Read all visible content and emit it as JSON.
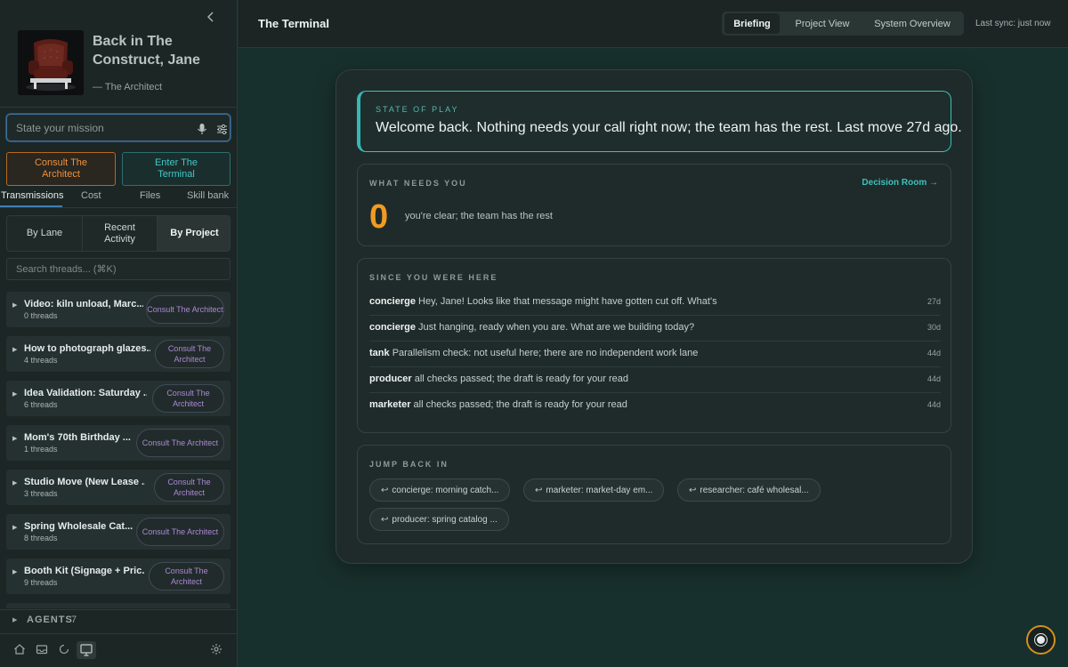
{
  "sidebar": {
    "hero": {
      "title": "Back in The Construct, Jane",
      "attribution": "— The Architect"
    },
    "mission_input": {
      "placeholder": "State your mission",
      "value": ""
    },
    "primary_buttons": {
      "consult": "Consult The Architect",
      "enter": "Enter The Terminal"
    },
    "tabs": [
      "Transmissions",
      "Cost",
      "Files",
      "Skill bank"
    ],
    "active_tab": "Transmissions",
    "grouping": [
      "By Lane",
      "Recent Activity",
      "By Project"
    ],
    "active_grouping": "By Project",
    "thread_search": {
      "placeholder": "Search threads... (⌘K)",
      "value": ""
    },
    "projects": [
      {
        "title": "Video: kiln unload, Marc...",
        "count": "0 threads",
        "action": "Consult The Architect"
      },
      {
        "title": "How to photograph glazes...",
        "count": "4 threads",
        "action": "Consult The Architect"
      },
      {
        "title": "Idea Validation: Saturday ...",
        "count": "6 threads",
        "action": "Consult The Architect"
      },
      {
        "title": "Mom's 70th Birthday ...",
        "count": "1 threads",
        "action": "Consult The Architect"
      },
      {
        "title": "Studio Move (New Lease ...",
        "count": "3 threads",
        "action": "Consult The Architect"
      },
      {
        "title": "Spring Wholesale Cat...",
        "count": "8 threads",
        "action": "Consult The Architect"
      },
      {
        "title": "Booth Kit (Signage + Pric...",
        "count": "9 threads",
        "action": "Consult The Architect"
      }
    ],
    "agents": {
      "label": "AGENTS",
      "count": "7"
    },
    "bottom_icons": [
      "home-icon",
      "inbox-icon",
      "refresh-icon",
      "monitor-icon",
      "gear-icon"
    ]
  },
  "topbar": {
    "title": "The Terminal",
    "nav": [
      "Briefing",
      "Project View",
      "System Overview"
    ],
    "active_nav": "Briefing",
    "last_sync": "Last sync: just now"
  },
  "briefing": {
    "state": {
      "kicker": "STATE OF PLAY",
      "message": "Welcome back. Nothing needs your call right now; the team has the rest. Last move 27d ago."
    },
    "needs": {
      "kicker": "WHAT NEEDS YOU",
      "link": "Decision Room →",
      "count": "0",
      "note": "you're clear; the team has the rest"
    },
    "since": {
      "kicker": "SINCE YOU WERE HERE",
      "items": [
        {
          "agent": "concierge",
          "text": "Hey, Jane! Looks like that message might have gotten cut off. What's",
          "age": "27d"
        },
        {
          "agent": "concierge",
          "text": "Just hanging, ready when you are. What are we building today?",
          "age": "30d"
        },
        {
          "agent": "tank",
          "text": "Parallelism check: not useful here; there are no independent work lane",
          "age": "44d"
        },
        {
          "agent": "producer",
          "text": "all checks passed; the draft is ready for your read",
          "age": "44d"
        },
        {
          "agent": "marketer",
          "text": "all checks passed; the draft is ready for your read",
          "age": "44d"
        }
      ]
    },
    "jump": {
      "kicker": "JUMP BACK IN",
      "chips": [
        "concierge: morning catch...",
        "marketer: market-day em...",
        "researcher: café wholesal...",
        "producer: spring catalog ..."
      ]
    }
  },
  "colors": {
    "accent_teal": "#3cc2bb",
    "accent_orange": "#f29a22",
    "accent_purple": "#a98ad6",
    "background": "#18302d"
  }
}
